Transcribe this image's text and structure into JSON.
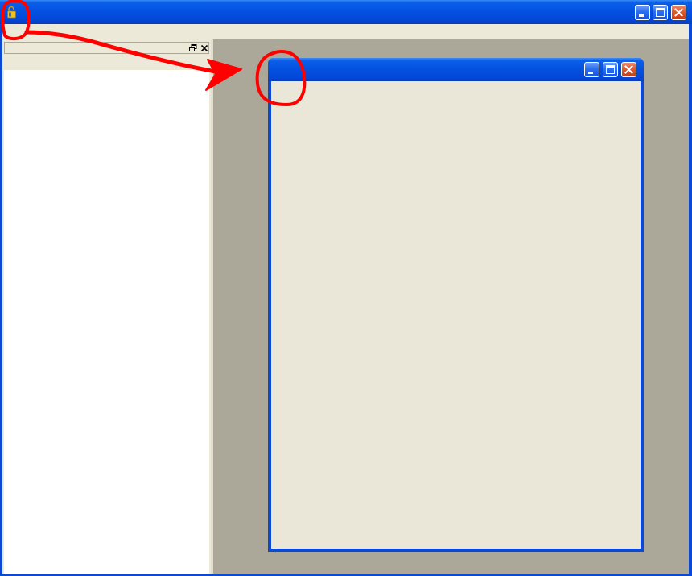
{
  "main_window": {
    "title": "",
    "icon": "padlock-icon",
    "buttons": [
      "minimize-icon",
      "maximize-icon",
      "close-icon"
    ]
  },
  "side_panel": {
    "title": "",
    "buttons": [
      "restore-icon",
      "close-icon"
    ]
  },
  "child_window": {
    "title": "",
    "buttons": [
      "minimize-icon",
      "maximize-icon",
      "close-icon"
    ]
  },
  "annotation": {
    "color": "#ff0000",
    "marks": [
      "circle-around-app-icon",
      "arrow",
      "circle-around-child-titlebar-icon-area"
    ]
  },
  "colors": {
    "titlebar": "#0450e0",
    "face": "#ece9d8",
    "mdi_background": "#aca899",
    "close_button": "#e05a32"
  }
}
